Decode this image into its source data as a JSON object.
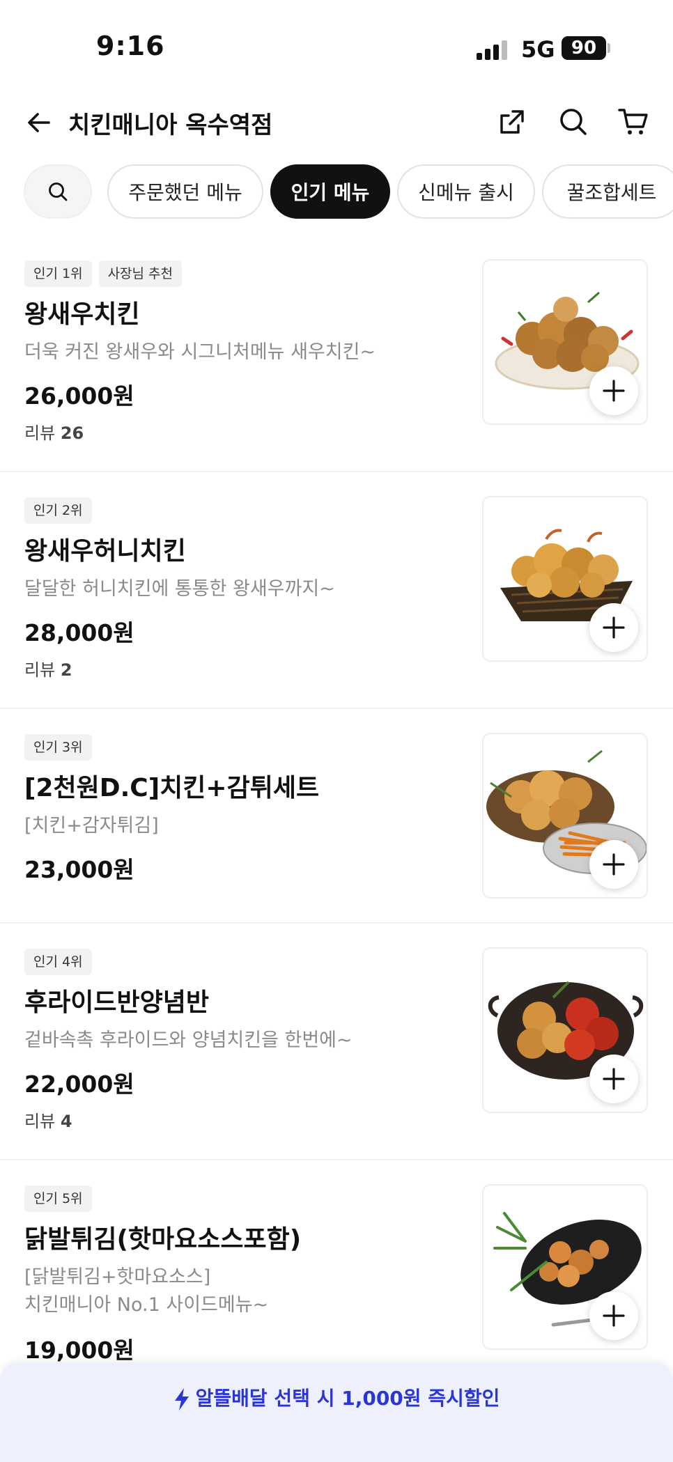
{
  "status_bar": {
    "time": "9:16",
    "network": "5G",
    "battery": "90"
  },
  "header": {
    "title": "치킨매니아 옥수역점"
  },
  "chips": [
    "주문했던 메뉴",
    "인기 메뉴",
    "신메뉴 출시",
    "꿀조합세트"
  ],
  "menu": [
    {
      "badges": [
        "인기 1위",
        "사장님 추천"
      ],
      "name": "왕새우치킨",
      "desc_lines": [
        "더욱 커진 왕새우와 시그니처메뉴 새우치킨~"
      ],
      "price": "26,000원",
      "review_label": "리뷰",
      "review_count": "26",
      "image": "fried-shrimp-chicken-plate"
    },
    {
      "badges": [
        "인기 2위"
      ],
      "name": "왕새우허니치킨",
      "desc_lines": [
        "달달한 허니치킨에 통통한 왕새우까지~"
      ],
      "price": "28,000원",
      "review_label": "리뷰",
      "review_count": "2",
      "image": "honey-shrimp-basket"
    },
    {
      "badges": [
        "인기 3위"
      ],
      "name": "[2천원D.C]치킨+감튀세트",
      "desc_lines": [
        "[치킨+감자튀김]"
      ],
      "price": "23,000원",
      "review_label": "",
      "review_count": "",
      "image": "chicken-and-fries"
    },
    {
      "badges": [
        "인기 4위"
      ],
      "name": "후라이드반양념반",
      "desc_lines": [
        "겉바속촉 후라이드와 양념치킨을 한번에~"
      ],
      "price": "22,000원",
      "review_label": "리뷰",
      "review_count": "4",
      "image": "half-fried-half-seasoned-pan"
    },
    {
      "badges": [
        "인기 5위"
      ],
      "name": "닭발튀김(핫마요소스포함)",
      "desc_lines": [
        "[닭발튀김+핫마요소스]",
        "치킨매니아 No.1 사이드메뉴~"
      ],
      "price": "19,000원",
      "review_label": "",
      "review_count": "",
      "image": "fried-chicken-feet-plate"
    }
  ],
  "promo": {
    "prefix": "알뜰배달 선택 시 ",
    "amount": "1,000",
    "suffix": "원 즉시할인"
  },
  "colors": {
    "active_chip": "#111111",
    "promo_bg": "#eef1fd",
    "promo_text": "#2a35d6",
    "desc_gray": "#8a8a8a"
  }
}
